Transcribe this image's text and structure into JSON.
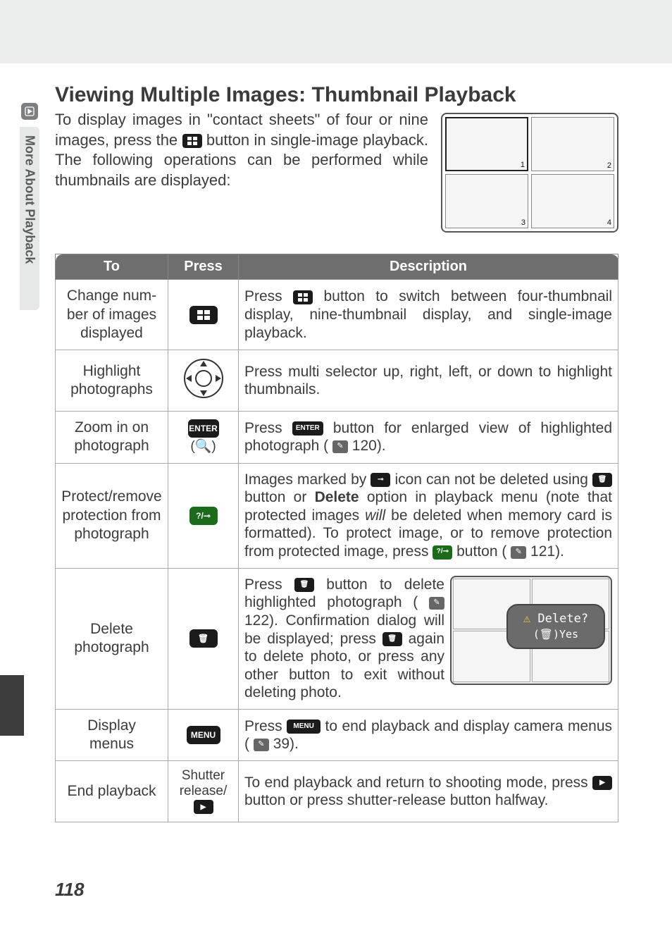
{
  "side_tab": {
    "label": "More About Playback"
  },
  "heading": "Viewing Multiple Images: Thumbnail Playback",
  "intro": {
    "part1": "To display images in \"contact sheets\" of four or nine images, press the ",
    "part2": " button in single-image playback.  The following operations can be performed while thumbnails are displayed:"
  },
  "columns": {
    "to": "To",
    "press": "Press",
    "desc": "Description"
  },
  "rows": [
    {
      "to": "Change num-\nber of images\ndisplayed",
      "press_icon": "thumb",
      "desc": {
        "a": "Press ",
        "b": " button to switch between four-thumbnail display, nine-thumbnail display, and single-image playback."
      }
    },
    {
      "to": "Highlight\nphotographs",
      "press_icon": "pad",
      "desc": {
        "a": "Press multi selector up, right, left, or down to highlight thumbnails."
      }
    },
    {
      "to": "Zoom in on\nphotograph",
      "press_icon": "enter-zoom",
      "press_label": "ENTER",
      "desc": {
        "a": "Press ",
        "b": " button for enlarged view of highlighted photograph (",
        "c": " 120)."
      }
    },
    {
      "to": "Protect/remove\nprotection from\nphotograph",
      "press_icon": "protect",
      "desc": {
        "a": "Images marked by ",
        "b": " icon can not be deleted using ",
        "c": " button or ",
        "bold1": "Delete",
        "d": " option in playback menu (note that protected images ",
        "ital1": "will",
        "e": " be deleted when memory card is formatted).  To protect image, or to remove protection from protected image, press ",
        "f": " button (",
        "g": " 121)."
      }
    },
    {
      "to": "Delete\nphotograph",
      "press_icon": "trash",
      "bubble": {
        "line1": "Delete?",
        "line2": "Yes"
      },
      "desc": {
        "a": "Press ",
        "b": " button to delete highlighted photograph (",
        "c": " 122).  Confirmation dialog will be displayed; press ",
        "d": " again to delete photo, or press any other button to exit without deleting photo."
      }
    },
    {
      "to": "Display\nmenus",
      "press_icon": "menu",
      "press_label": "MENU",
      "desc": {
        "a": "Press ",
        "b": " to end playback and display camera menus (",
        "c": " 39)."
      }
    },
    {
      "to": "End playback",
      "press_text": "Shutter\nrelease/",
      "press_icon": "playback",
      "desc": {
        "a": "To end playback and return to shooting mode, press ",
        "b": " button or press shutter-release button halfway."
      }
    }
  ],
  "page_number": "118"
}
